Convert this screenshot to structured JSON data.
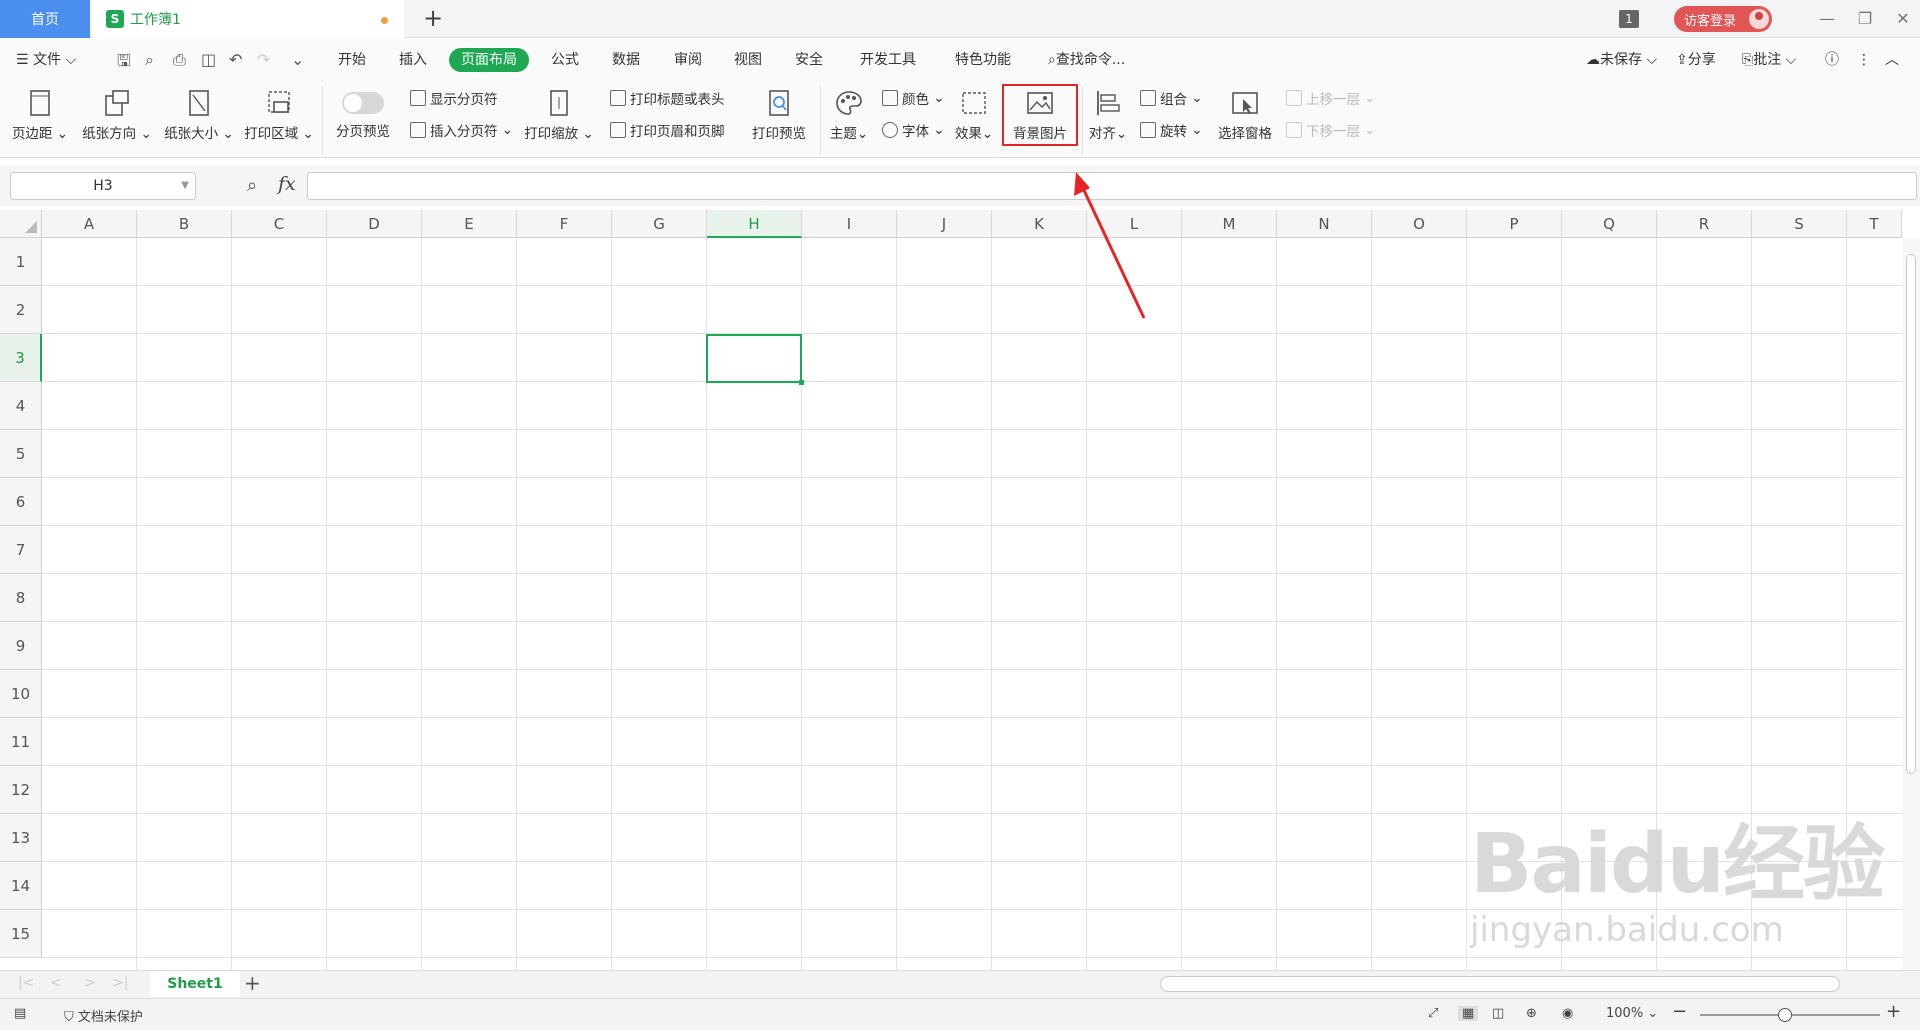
{
  "titlebar": {
    "home_tab": "首页",
    "doc_tab": "工作簿1",
    "doc_icon": "S",
    "notification_count": "1",
    "login_label": "访客登录"
  },
  "menubar": {
    "file": "文件",
    "tabs": [
      "开始",
      "插入",
      "页面布局",
      "公式",
      "数据",
      "审阅",
      "视图",
      "安全",
      "开发工具",
      "特色功能"
    ],
    "active_tab": "页面布局",
    "search": "查找命令...",
    "unsaved": "未保存",
    "share": "分享",
    "comment": "批注"
  },
  "ribbon": {
    "margins": "页边距",
    "orientation": "纸张方向",
    "size": "纸张大小",
    "print_area": "打印区域",
    "page_break_preview": "分页预览",
    "show_page_breaks": "显示分页符",
    "insert_page_break": "插入分页符",
    "print_scale": "打印缩放",
    "print_titles": "打印标题或表头",
    "print_header_footer": "打印页眉和页脚",
    "print_preview": "打印预览",
    "theme": "主题",
    "colors": "颜色",
    "fonts": "字体",
    "effects": "效果",
    "background_image": "背景图片",
    "align": "对齐",
    "group": "组合",
    "rotate": "旋转",
    "selection_pane": "选择窗格",
    "bring_forward": "上移一层",
    "send_backward": "下移一层"
  },
  "formula": {
    "name_box": "H3",
    "fx": "fx"
  },
  "grid": {
    "columns": [
      "A",
      "B",
      "C",
      "D",
      "E",
      "F",
      "G",
      "H",
      "I",
      "J",
      "K",
      "L",
      "M",
      "N",
      "O",
      "P",
      "Q",
      "R",
      "S",
      "T"
    ],
    "rows": [
      "1",
      "2",
      "3",
      "4",
      "5",
      "6",
      "7",
      "8",
      "9",
      "10",
      "11",
      "12",
      "13",
      "14",
      "15"
    ],
    "selected_column": "H",
    "selected_row": "3"
  },
  "sheets": {
    "tabs": [
      "Sheet1"
    ],
    "add": "+"
  },
  "statusbar": {
    "protection": "文档未保护",
    "zoom": "100%"
  },
  "watermark": {
    "brand": "Baidu经验",
    "url": "jingyan.baidu.com"
  },
  "colors": {
    "accent_green": "#1fa854",
    "home_tab_blue": "#4a8ef0",
    "highlight_red": "#e52525",
    "login_red": "#e15555"
  }
}
